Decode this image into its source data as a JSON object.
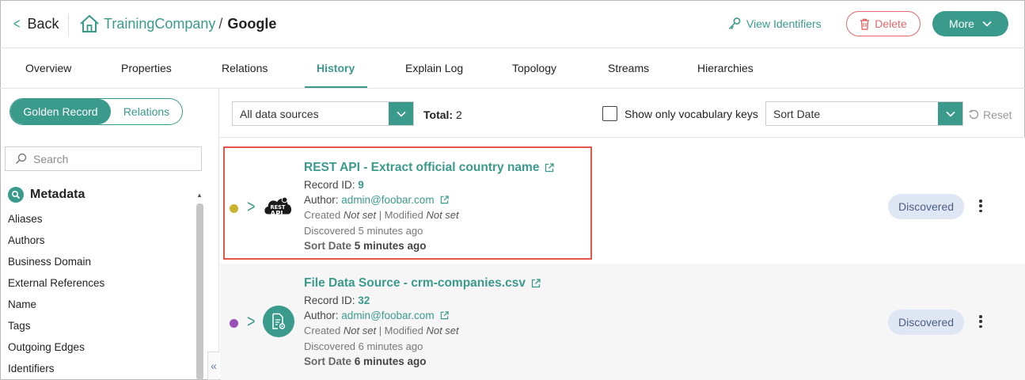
{
  "header": {
    "back_label": "Back",
    "org_name": "TrainingCompany",
    "separator": "/",
    "entity_name": "Google",
    "view_identifiers_label": "View Identifiers",
    "delete_label": "Delete",
    "more_label": "More"
  },
  "tabs": [
    {
      "label": "Overview"
    },
    {
      "label": "Properties"
    },
    {
      "label": "Relations"
    },
    {
      "label": "History",
      "active": true
    },
    {
      "label": "Explain Log"
    },
    {
      "label": "Topology"
    },
    {
      "label": "Streams"
    },
    {
      "label": "Hierarchies"
    }
  ],
  "left_panel": {
    "toggle": {
      "golden_record": "Golden Record",
      "relations": "Relations"
    },
    "search_placeholder": "Search",
    "section_title": "Metadata",
    "items": [
      "Aliases",
      "Authors",
      "Business Domain",
      "External References",
      "Name",
      "Tags",
      "Outgoing Edges",
      "Identifiers"
    ],
    "collapse_glyph": "«"
  },
  "filters": {
    "data_sources_value": "All data sources",
    "total_label": "Total:",
    "total_value": "2",
    "vocab_checkbox_label": "Show only vocabulary keys",
    "sort_value": "Sort Date",
    "reset_label": "Reset"
  },
  "records": [
    {
      "title": "REST API - Extract official country name",
      "record_id_label": "Record ID:",
      "record_id": "9",
      "author_label": "Author:",
      "author": "admin@foobar.com",
      "created_label": "Created",
      "created_value": "Not set",
      "modified_label": "| Modified",
      "modified_value": "Not set",
      "discovered_text": "Discovered 5 minutes ago",
      "sort_label": "Sort Date",
      "sort_value": "5 minutes ago",
      "status": "Discovered",
      "dot_color": "#c9b431",
      "icon_text_top": "REST",
      "icon_text_bottom": "API"
    },
    {
      "title": "File Data Source - crm-companies.csv",
      "record_id_label": "Record ID:",
      "record_id": "32",
      "author_label": "Author:",
      "author": "admin@foobar.com",
      "created_label": "Created",
      "created_value": "Not set",
      "modified_label": "| Modified",
      "modified_value": "Not set",
      "discovered_text": "Discovered 6 minutes ago",
      "sort_label": "Sort Date",
      "sort_value": "6 minutes ago",
      "status": "Discovered",
      "dot_color": "#9b4fb8"
    }
  ],
  "colors": {
    "accent": "#3a9a8c",
    "danger": "#e36a6a",
    "highlight": "#e2574c",
    "badge_bg": "#dfe6f4"
  }
}
